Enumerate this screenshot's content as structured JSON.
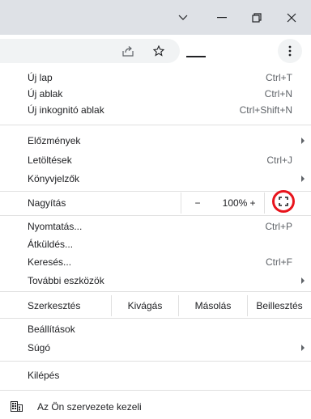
{
  "window_controls": {
    "dropdown_icon": "chevron-down-icon",
    "minimize_icon": "minimize-icon",
    "restore_icon": "restore-icon",
    "close_icon": "close-icon"
  },
  "toolbar": {
    "share_icon": "share-icon",
    "bookmark_icon": "star-icon",
    "menu_icon": "kebab-menu-icon"
  },
  "menu": {
    "group1": [
      {
        "label": "Új lap",
        "shortcut": "Ctrl+T"
      },
      {
        "label": "Új ablak",
        "shortcut": "Ctrl+N"
      },
      {
        "label": "Új inkognitó ablak",
        "shortcut": "Ctrl+Shift+N"
      }
    ],
    "group2": [
      {
        "label": "Előzmények",
        "shortcut": ""
      },
      {
        "label": "Letöltések",
        "shortcut": "Ctrl+J"
      },
      {
        "label": "Könyvjelzők",
        "shortcut": ""
      }
    ],
    "zoom": {
      "label": "Nagyítás",
      "minus": "−",
      "value": "100%",
      "plus": "+",
      "fullscreen_icon": "fullscreen-icon",
      "highlight_color": "#e8141c"
    },
    "group3": [
      {
        "label": "Nyomtatás...",
        "shortcut": "Ctrl+P"
      },
      {
        "label": "Átküldés...",
        "shortcut": ""
      },
      {
        "label": "Keresés...",
        "shortcut": "Ctrl+F"
      },
      {
        "label": "További eszközök",
        "shortcut": ""
      }
    ],
    "edit": {
      "label": "Szerkesztés",
      "cut": "Kivágás",
      "copy": "Másolás",
      "paste": "Beillesztés"
    },
    "group4": [
      {
        "label": "Beállítások",
        "shortcut": ""
      },
      {
        "label": "Súgó",
        "shortcut": ""
      }
    ],
    "exit": {
      "label": "Kilépés"
    },
    "managed": {
      "label": "Az Ön szervezete kezeli",
      "icon": "building-icon"
    }
  }
}
